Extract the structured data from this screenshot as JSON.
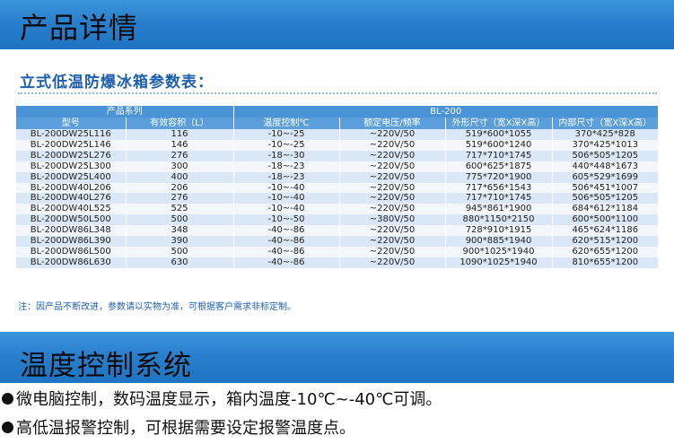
{
  "banner_top": {
    "title": "产品详情"
  },
  "subtitle": "立式低温防爆冰箱参数表：",
  "table": {
    "series_label": "产品系列",
    "series_value": "BL-200",
    "headers": [
      "型号",
      "有效容积（L）",
      "温度控制℃",
      "额定电压/频率",
      "外形尺寸（宽X深X高）",
      "内部尺寸（宽X深X高）"
    ],
    "rows": [
      [
        "BL-200DW25L116",
        "116",
        "-10~-25",
        "~220V/50",
        "519*600*1055",
        "370*425*828"
      ],
      [
        "BL-200DW25L146",
        "146",
        "-10~-25",
        "~220V/50",
        "519*600*1240",
        "370*425*1013"
      ],
      [
        "BL-200DW25L276",
        "276",
        "-18~-30",
        "~220V/50",
        "717*710*1745",
        "506*505*1205"
      ],
      [
        "BL-200DW25L300",
        "300",
        "-18~-23",
        "~220V/50",
        "600*625*1875",
        "440*448*1673"
      ],
      [
        "BL-200DW25L400",
        "400",
        "-18~-23",
        "~220V/50",
        "775*720*1900",
        "605*529*1699"
      ],
      [
        "BL-200DW40L206",
        "206",
        "-10~-40",
        "~220V/50",
        "717*656*1543",
        "506*451*1007"
      ],
      [
        "BL-200DW40L276",
        "276",
        "-10~-40",
        "~220V/50",
        "717*710*1745",
        "506*505*1205"
      ],
      [
        "BL-200DW40L525",
        "525",
        "-10~-40",
        "~220V/50",
        "945*861*1900",
        "684*612*1184"
      ],
      [
        "BL-200DW50L500",
        "500",
        "-10~-50",
        "~380V/50",
        "880*1150*2150",
        "600*500*1100"
      ],
      [
        "BL-200DW86L348",
        "348",
        "-40~-86",
        "~220V/50",
        "728*910*1915",
        "465*624*1186"
      ],
      [
        "BL-200DW86L390",
        "390",
        "-40~-86",
        "~220V/50",
        "900*885*1940",
        "620*515*1200"
      ],
      [
        "BL-200DW86L500",
        "500",
        "-40~-86",
        "~220V/50",
        "900*1025*1940",
        "620*655*1200"
      ],
      [
        "BL-200DW86L630",
        "630",
        "-40~-86",
        "~220V/50",
        "1090*1025*1940",
        "810*655*1200"
      ]
    ]
  },
  "note": "注：因产品不断改进，参数请以实物为准，可根据客户需求非标定制。",
  "banner_bottom": {
    "title": "温度控制系统"
  },
  "features": [
    "微电脑控制，数码温度显示，箱内温度-10℃~-40℃可调。",
    "高低温报警控制，可根据需要设定报警温度点。"
  ],
  "colors": {
    "banner": "#2a7fcc",
    "subtitle": "#1d5fae",
    "header": "#4a93d6",
    "row_odd": "#d9e7f6",
    "row_even": "#f3f7fc"
  }
}
